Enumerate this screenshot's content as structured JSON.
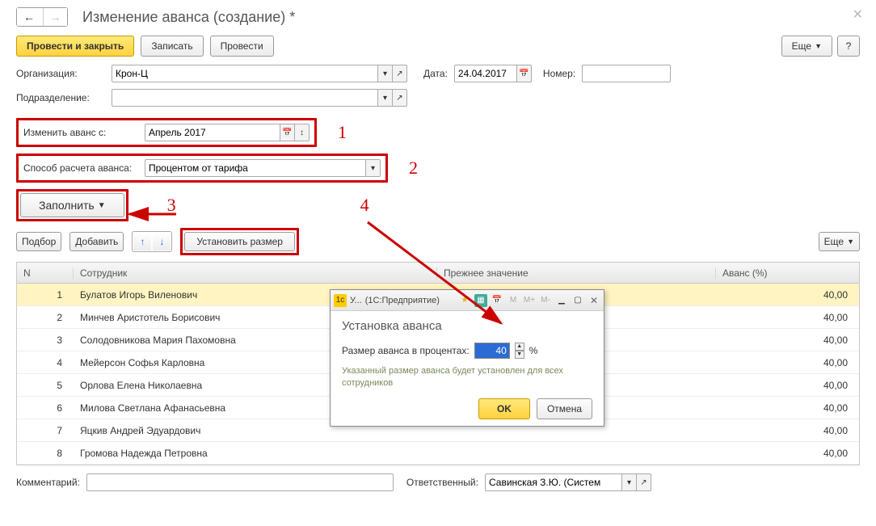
{
  "header": {
    "title": "Изменение аванса (создание) *"
  },
  "toolbar": {
    "post_close": "Провести и закрыть",
    "save": "Записать",
    "post": "Провести",
    "more": "Еще",
    "help": "?"
  },
  "form": {
    "org_label": "Организация:",
    "org_value": "Крон-Ц",
    "date_label": "Дата:",
    "date_value": "24.04.2017",
    "number_label": "Номер:",
    "number_value": "",
    "dept_label": "Подразделение:",
    "dept_value": "",
    "change_from_label": "Изменить аванс с:",
    "change_from_value": "Апрель 2017",
    "method_label": "Способ расчета аванса:",
    "method_value": "Процентом от тарифа"
  },
  "markers": {
    "m1": "1",
    "m2": "2",
    "m3": "3",
    "m4": "4"
  },
  "actions": {
    "fill": "Заполнить",
    "pick": "Подбор",
    "add": "Добавить",
    "set_size": "Установить размер",
    "more2": "Еще"
  },
  "grid": {
    "cols": {
      "n": "N",
      "emp": "Сотрудник",
      "prev": "Прежнее значение",
      "adv": "Аванс (%)"
    },
    "rows": [
      {
        "n": "1",
        "emp": "Булатов Игорь Виленович",
        "adv": "40,00",
        "sel": true
      },
      {
        "n": "2",
        "emp": "Минчев Аристотель Борисович",
        "adv": "40,00"
      },
      {
        "n": "3",
        "emp": "Солодовникова Мария Пахомовна",
        "adv": "40,00"
      },
      {
        "n": "4",
        "emp": "Мейерсон Софья Карловна",
        "adv": "40,00"
      },
      {
        "n": "5",
        "emp": "Орлова Елена Николаевна",
        "adv": "40,00"
      },
      {
        "n": "6",
        "emp": "Милова Светлана Афанасьевна",
        "adv": "40,00"
      },
      {
        "n": "7",
        "emp": "Яцкив Андрей Эдуардович",
        "adv": "40,00"
      },
      {
        "n": "8",
        "emp": "Громова Надежда Петровна",
        "adv": "40,00"
      }
    ]
  },
  "footer": {
    "comment_label": "Комментарий:",
    "comment_value": "",
    "resp_label": "Ответственный:",
    "resp_value": "Савинская З.Ю. (Систем"
  },
  "dialog": {
    "titlebar_short": "У...",
    "titlebar_app": "(1С:Предприятие)",
    "heading": "Установка аванса",
    "field_label": "Размер аванса в процентах:",
    "field_value": "40",
    "pct": "%",
    "hint": "Указанный размер аванса будет установлен для всех сотрудников",
    "ok": "OK",
    "cancel": "Отмена",
    "m": "M",
    "mplus": "M+",
    "mminus": "M-"
  }
}
